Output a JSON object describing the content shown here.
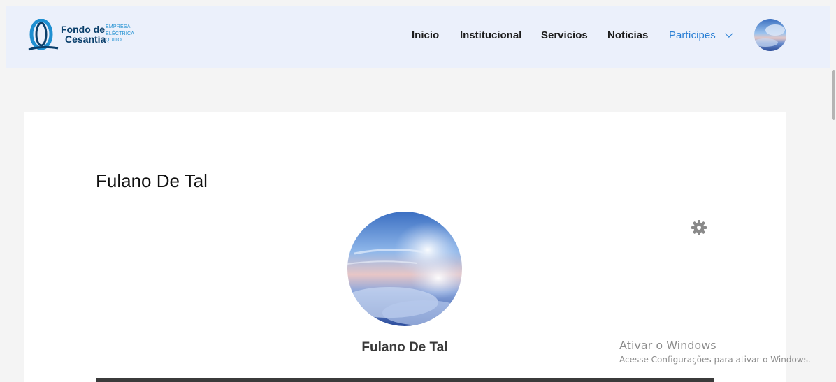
{
  "header": {
    "logo": {
      "name_line1": "Fondo de",
      "name_line2": "Cesantía",
      "sub_line1": "EMPRESA",
      "sub_line2": "ELÉCTRICA",
      "sub_line3": "QUITO"
    },
    "nav": [
      {
        "label": "Inicio"
      },
      {
        "label": "Institucional"
      },
      {
        "label": "Servicios"
      },
      {
        "label": "Noticias"
      },
      {
        "label": "Partícipes",
        "active": true
      }
    ],
    "accent_color": "#2a7fd4"
  },
  "profile": {
    "title": "Fulano De Tal",
    "name": "Fulano De Tal",
    "settings_icon": "gear-icon"
  },
  "watermark": {
    "line1": "Ativar o Windows",
    "line2": "Acesse Configurações para ativar o Windows."
  }
}
